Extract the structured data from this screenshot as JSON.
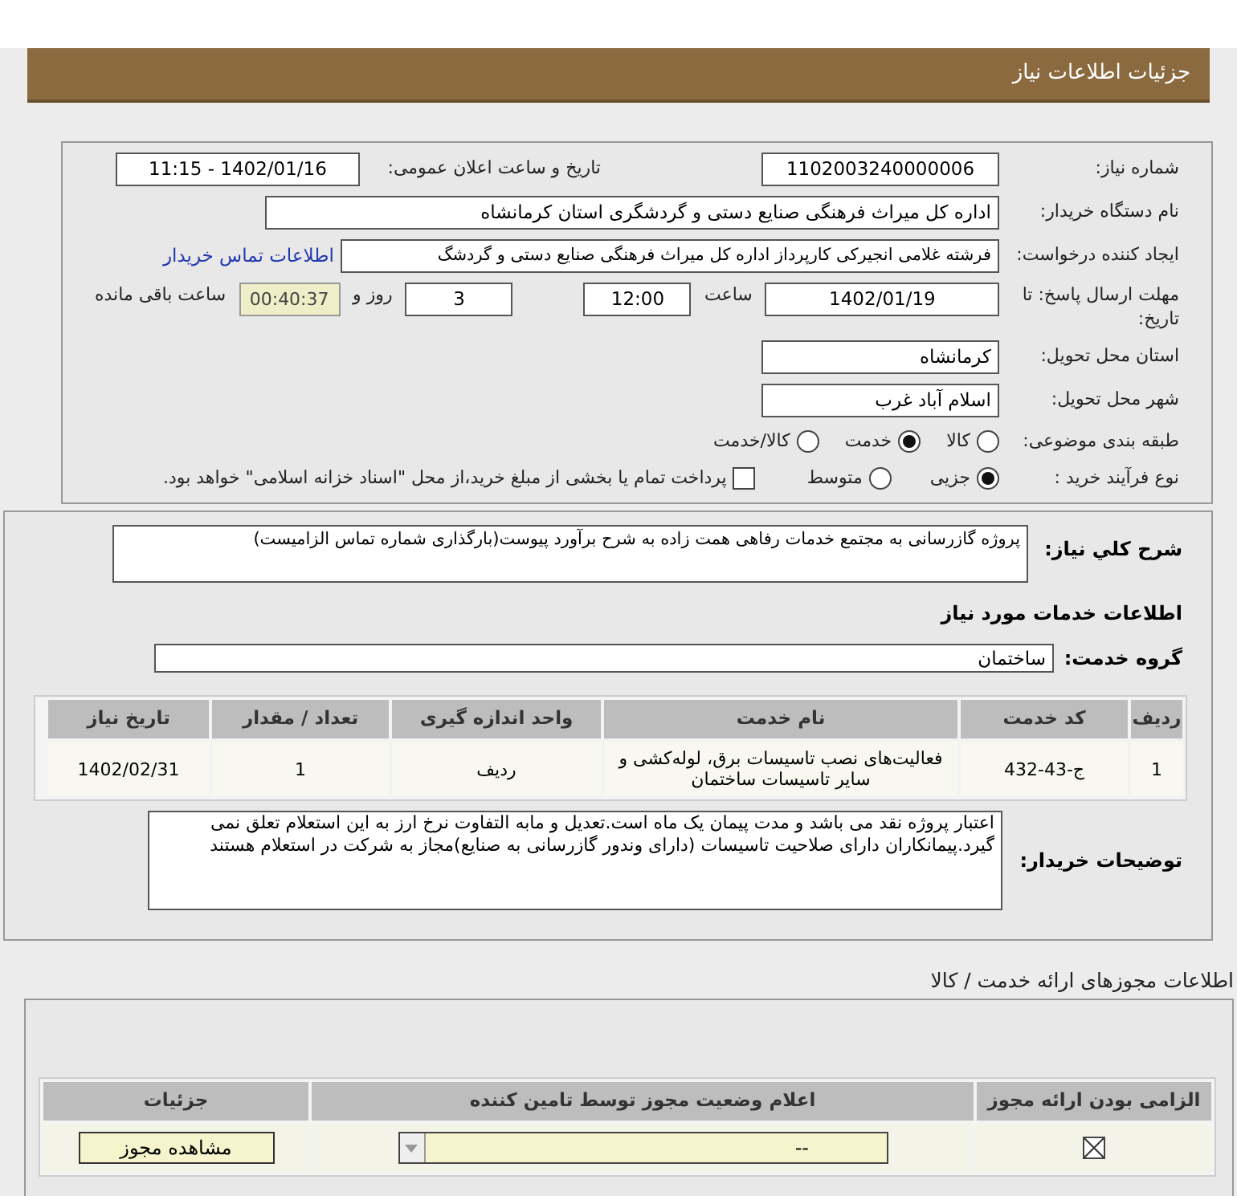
{
  "title": "جزئیات اطلاعات نیاز",
  "need_number": {
    "label": "شماره نیاز:",
    "value": "1102003240000006"
  },
  "announce": {
    "label": "تاریخ و ساعت اعلان عمومی:",
    "value": "1402/01/16 - 11:15"
  },
  "buyer": {
    "label": "نام دستگاه خریدار:",
    "value": "اداره کل میراث فرهنگی  صنایع دستی و گردشگری استان کرمانشاه"
  },
  "creator": {
    "label": "ایجاد کننده درخواست:",
    "value": "فرشته غلامی انجیرکی کارپرداز اداره کل میراث فرهنگی  صنایع دستی و گردشگ",
    "link": "اطلاعات تماس خریدار"
  },
  "deadline": {
    "label": "مهلت ارسال پاسخ: تا تاریخ:",
    "date": "1402/01/19",
    "time_label": "ساعت",
    "time": "12:00",
    "days": "3",
    "days_label": "روز و",
    "remaining": "00:40:37",
    "remaining_label": "ساعت باقی مانده"
  },
  "province": {
    "label": "استان محل تحویل:",
    "value": "کرمانشاه"
  },
  "city": {
    "label": "شهر محل تحویل:",
    "value": "اسلام آباد غرب"
  },
  "category": {
    "label": "طبقه بندی موضوعی:",
    "options": [
      {
        "label": "کالا",
        "selected": false
      },
      {
        "label": "خدمت",
        "selected": true
      },
      {
        "label": "کالا/خدمت",
        "selected": false
      }
    ]
  },
  "process": {
    "label": "نوع فرآیند خرید :",
    "options": [
      {
        "label": "جزیی",
        "selected": true
      },
      {
        "label": "متوسط",
        "selected": false
      }
    ],
    "treasury": {
      "label": "پرداخت تمام یا بخشی از مبلغ خرید،از محل \"اسناد خزانه اسلامی\" خواهد بود.",
      "checked": false
    }
  },
  "description": {
    "label": "شرح کلي نیاز:",
    "value": "پروژه گازرسانی به مجتمع خدمات رفاهی همت زاده به شرح برآورد پیوست(بارگذاری شماره تماس الزامیست)"
  },
  "services_heading": "اطلاعات خدمات مورد نیاز",
  "service_group": {
    "label": "گروه خدمت:",
    "value": "ساختمان"
  },
  "services_table": {
    "columns": [
      "ردیف",
      "کد خدمت",
      "نام خدمت",
      "واحد اندازه گیری",
      "تعداد / مقدار",
      "تاریخ نیاز"
    ],
    "rows": [
      [
        "1",
        "ج-43-432",
        "فعالیت‌های نصب تاسیسات برق، لوله‌کشی و سایر تاسیسات ساختمان",
        "ردیف",
        "1",
        "1402/02/31"
      ]
    ]
  },
  "buyer_notes": {
    "label": "توضیحات خریدار:",
    "value": "اعتبار پروژه نقد می باشد و مدت پیمان یک ماه است.تعدیل و مابه التفاوت نرخ ارز به این استعلام تعلق نمی گیرد.پیمانکاران دارای صلاحیت تاسیسات (دارای وندور گازرسانی به صنایع)مجاز به شرکت در استعلام هستند"
  },
  "licenses_heading": "اطلاعات مجوزهای ارائه خدمت / کالا",
  "licenses_table": {
    "columns": [
      "الزامی بودن ارائه مجوز",
      "اعلام وضعیت مجوز توسط تامین کننده",
      "جزئیات"
    ],
    "rows": [
      {
        "required": true,
        "status": "--",
        "button": "مشاهده مجوز"
      }
    ]
  }
}
